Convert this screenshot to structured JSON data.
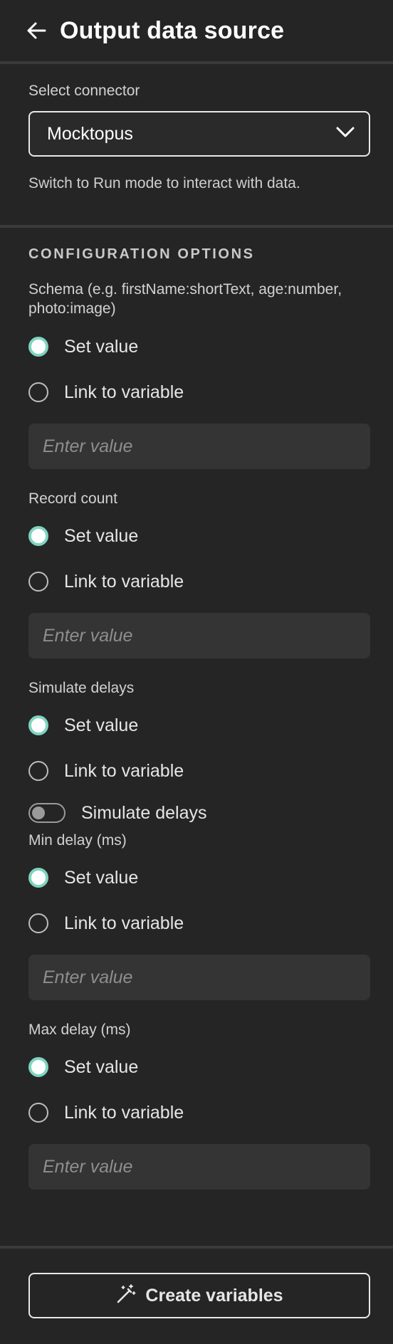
{
  "header": {
    "title": "Output data source",
    "back_icon": "arrow-left-icon"
  },
  "connector": {
    "label": "Select connector",
    "selected": "Mocktopus",
    "hint": "Switch to Run mode to interact with data."
  },
  "config": {
    "heading": "CONFIGURATION OPTIONS",
    "fields": [
      {
        "label": "Schema (e.g. firstName:shortText, age:number, photo:image)",
        "option_set": "Set value",
        "option_link": "Link to variable",
        "placeholder": "Enter value",
        "selected": "Set value"
      },
      {
        "label": "Record count",
        "option_set": "Set value",
        "option_link": "Link to variable",
        "placeholder": "Enter value",
        "selected": "Set value"
      },
      {
        "label": "Simulate delays",
        "option_set": "Set value",
        "option_link": "Link to variable",
        "toggle_label": "Simulate delays",
        "toggle_on": false,
        "selected": "Set value"
      },
      {
        "label": "Min delay (ms)",
        "option_set": "Set value",
        "option_link": "Link to variable",
        "placeholder": "Enter value",
        "selected": "Set value"
      },
      {
        "label": "Max delay (ms)",
        "option_set": "Set value",
        "option_link": "Link to variable",
        "placeholder": "Enter value",
        "selected": "Set value"
      }
    ]
  },
  "footer": {
    "create_label": "Create variables",
    "create_icon": "magic-wand-icon"
  },
  "colors": {
    "background": "#252525",
    "accent": "#7fd4bf",
    "input_bg": "#343434"
  }
}
